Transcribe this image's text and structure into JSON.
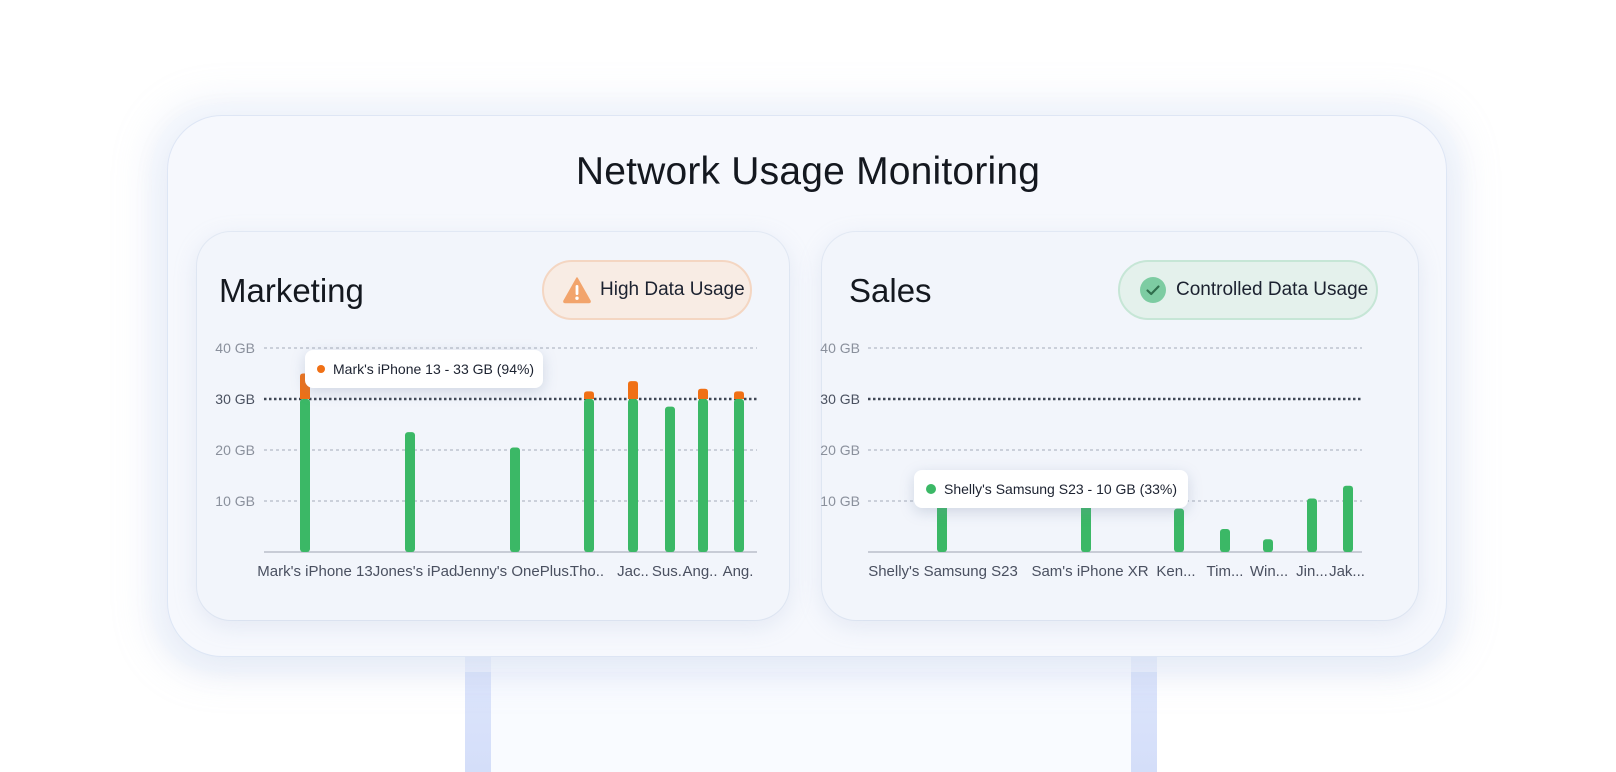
{
  "title": "Network Usage Monitoring",
  "colors": {
    "normal": "#3bb866",
    "over": "#f07015",
    "warn_icon": "#f2a46c",
    "ok_icon": "#7dcca2"
  },
  "panels": [
    {
      "title": "Marketing",
      "status": {
        "label": "High Data Usage",
        "icon": "warning-icon"
      },
      "tooltip": "Mark's iPhone 13 - 33 GB (94%)"
    },
    {
      "title": "Sales",
      "status": {
        "label": "Controlled Data Usage",
        "icon": "check-circle-icon"
      },
      "tooltip": "Shelly's Samsung S23 - 10 GB (33%)"
    }
  ],
  "chart_data": [
    {
      "type": "bar",
      "title": "Marketing",
      "ylim": [
        0,
        40
      ],
      "yticks": [
        "40 GB",
        "30 GB",
        "20 GB",
        "10 GB"
      ],
      "threshold": 30,
      "categories": [
        "Mark's iPhone 13",
        "Jones's iPad",
        "Jenny's OnePlus..",
        "Tho..",
        "Jac..",
        "Sus..",
        "Ang..",
        "Ang."
      ],
      "values": [
        35,
        23.5,
        20.5,
        31.5,
        33.5,
        28.5,
        32,
        31.5
      ]
    },
    {
      "type": "bar",
      "title": "Sales",
      "ylim": [
        0,
        40
      ],
      "yticks": [
        "40 GB",
        "30 GB",
        "20 GB",
        "10 GB"
      ],
      "threshold": 30,
      "categories": [
        "Shelly's Samsung S23",
        "Sam's iPhone XR",
        "Ken...",
        "Tim...",
        "Win...",
        "Jin...",
        "Jak..."
      ],
      "values": [
        10,
        11.5,
        8.5,
        4.5,
        2.5,
        10.5,
        13
      ]
    }
  ]
}
